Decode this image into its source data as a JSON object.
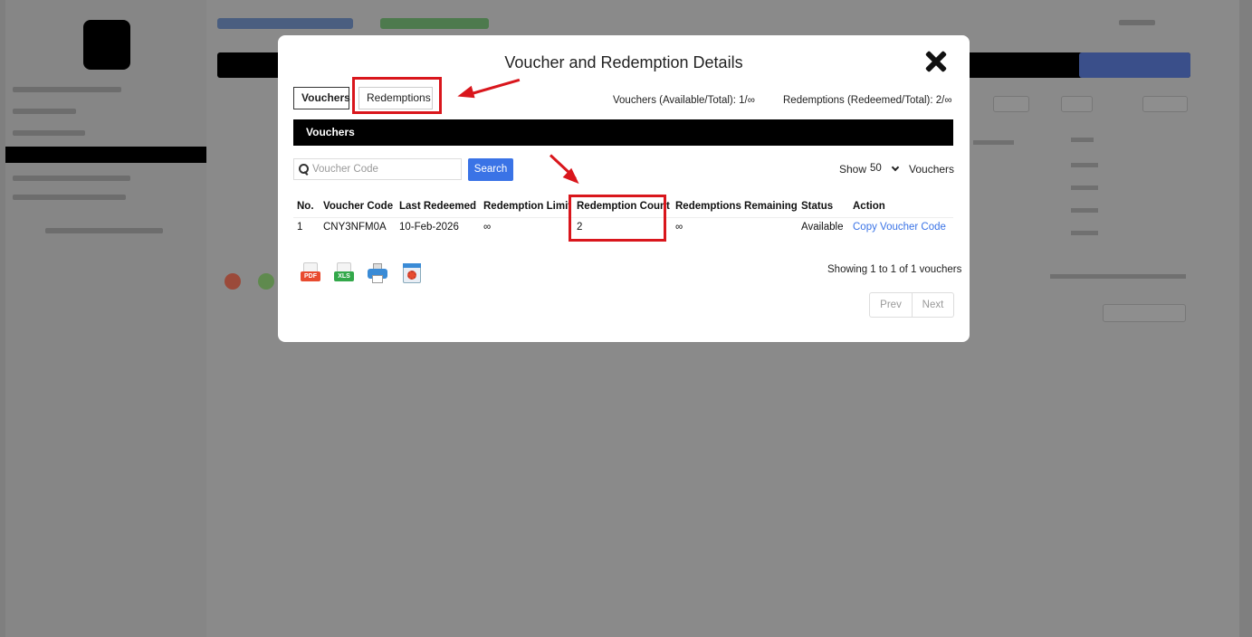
{
  "modal": {
    "title": "Voucher and Redemption Details",
    "tabs": [
      {
        "label": "Vouchers",
        "active": true
      },
      {
        "label": "Redemptions",
        "active": false
      }
    ],
    "summary": {
      "vouchers": "Vouchers (Available/Total): 1/∞",
      "redemptions": "Redemptions (Redeemed/Total): 2/∞"
    },
    "section_title": "Vouchers",
    "search": {
      "placeholder": "Voucher Code",
      "button_label": "Search"
    },
    "show": {
      "label": "Show",
      "selected": "50",
      "suffix": "Vouchers"
    },
    "table": {
      "columns": [
        "No.",
        "Voucher Code",
        "Last Redeemed",
        "Redemption Limit",
        "Redemption Count",
        "Redemptions Remaining",
        "Status",
        "Action"
      ],
      "rows": [
        {
          "no": "1",
          "code": "CNY3NFM0A",
          "last_redeemed": "10-Feb-2026",
          "limit": "∞",
          "count": "2",
          "remaining": "∞",
          "status": "Available",
          "action": "Copy Voucher Code"
        }
      ]
    },
    "export_icons": [
      "pdf-icon",
      "xls-icon",
      "print-icon",
      "settings-icon"
    ],
    "export_labels": {
      "pdf": "PDF",
      "xls": "XLS"
    },
    "showing": "Showing 1 to 1 of 1 vouchers",
    "pager": {
      "prev": "Prev",
      "next": "Next"
    }
  },
  "annotation_color": "#d9161c",
  "colors": {
    "accent": "#3a73e6",
    "section_bar": "#000000",
    "overlay": "#7f7f7f"
  }
}
